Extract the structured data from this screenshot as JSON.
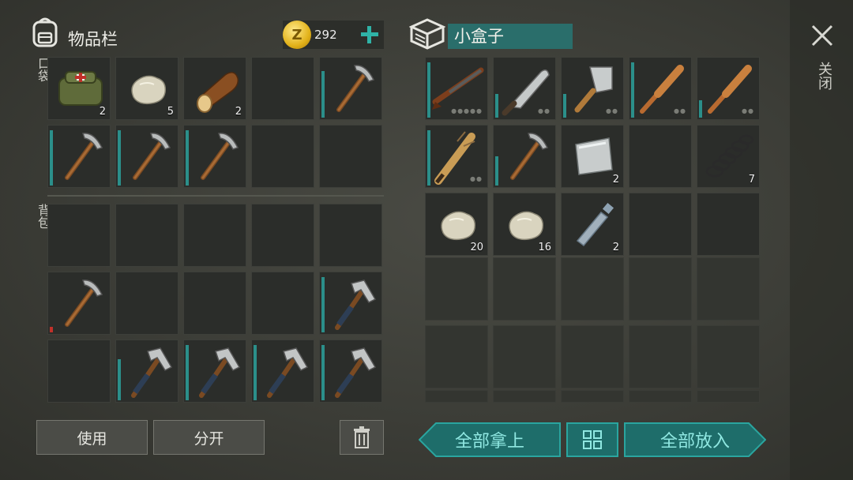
{
  "inventory": {
    "title": "物品栏",
    "icon": "backpack-icon",
    "coins": "292",
    "coin_symbol": "Z",
    "section_pocket": "口袋",
    "section_backpack": "背包",
    "pocket_rows": [
      [
        {
          "icon": "first-aid-bag",
          "count": "2"
        },
        {
          "icon": "stone",
          "count": "5"
        },
        {
          "icon": "log",
          "count": "2"
        },
        {
          "icon": "",
          "count": ""
        },
        {
          "icon": "pickaxe",
          "count": "",
          "dur": 0.8
        }
      ],
      [
        {
          "icon": "pickaxe",
          "count": "",
          "dur": 0.95
        },
        {
          "icon": "pickaxe",
          "count": "",
          "dur": 0.95
        },
        {
          "icon": "pickaxe",
          "count": "",
          "dur": 0.95
        },
        {
          "icon": "",
          "count": ""
        },
        {
          "icon": "",
          "count": ""
        }
      ]
    ],
    "backpack_rows": [
      [
        {
          "icon": ""
        },
        {
          "icon": ""
        },
        {
          "icon": ""
        },
        {
          "icon": ""
        },
        {
          "icon": ""
        }
      ],
      [
        {
          "icon": "pickaxe",
          "dur": 0.1,
          "red": true
        },
        {
          "icon": ""
        },
        {
          "icon": ""
        },
        {
          "icon": ""
        },
        {
          "icon": "hammer-pick",
          "dur": 0.95
        }
      ],
      [
        {
          "icon": ""
        },
        {
          "icon": "hammer-pick",
          "dur": 0.7
        },
        {
          "icon": "hammer-pick",
          "dur": 0.95
        },
        {
          "icon": "hammer-pick",
          "dur": 0.95
        },
        {
          "icon": "hammer-pick",
          "dur": 0.95
        }
      ]
    ],
    "use_label": "使用",
    "split_label": "分开",
    "trash_icon": "trash-icon"
  },
  "box": {
    "title": "小盒子",
    "icon": "box-icon",
    "rows": [
      [
        {
          "icon": "rifle",
          "count": "",
          "dur": 0.95,
          "dots": "●●●●●"
        },
        {
          "icon": "machete",
          "count": "",
          "dur": 0.4,
          "dots": "●●"
        },
        {
          "icon": "cleaver",
          "count": "",
          "dur": 0.4,
          "dots": "●●"
        },
        {
          "icon": "bat",
          "count": "",
          "dur": 0.95,
          "dots": "●●"
        },
        {
          "icon": "bat",
          "count": "",
          "dur": 0.3,
          "dots": "●●"
        }
      ],
      [
        {
          "icon": "spiked-bat",
          "count": "",
          "dur": 0.95,
          "dots": "●●"
        },
        {
          "icon": "pickaxe",
          "count": "",
          "dur": 0.5,
          "dots": ""
        },
        {
          "icon": "metal-sheet",
          "count": "2"
        },
        {
          "icon": "",
          "count": ""
        },
        {
          "icon": "spring",
          "count": "7"
        }
      ],
      [
        {
          "icon": "stone",
          "count": "20"
        },
        {
          "icon": "stone",
          "count": "16"
        },
        {
          "icon": "bottle",
          "count": "2"
        },
        {
          "icon": "",
          "count": ""
        },
        {
          "icon": "",
          "count": ""
        }
      ]
    ],
    "take_all_label": "全部拿上",
    "put_all_label": "全部放入",
    "sort_icon": "grid-sort-icon"
  },
  "close_label": "关闭",
  "colors": {
    "teal": "#1f7b78",
    "teal_text": "#8fe7e1",
    "durability": "#2b8f8a"
  }
}
